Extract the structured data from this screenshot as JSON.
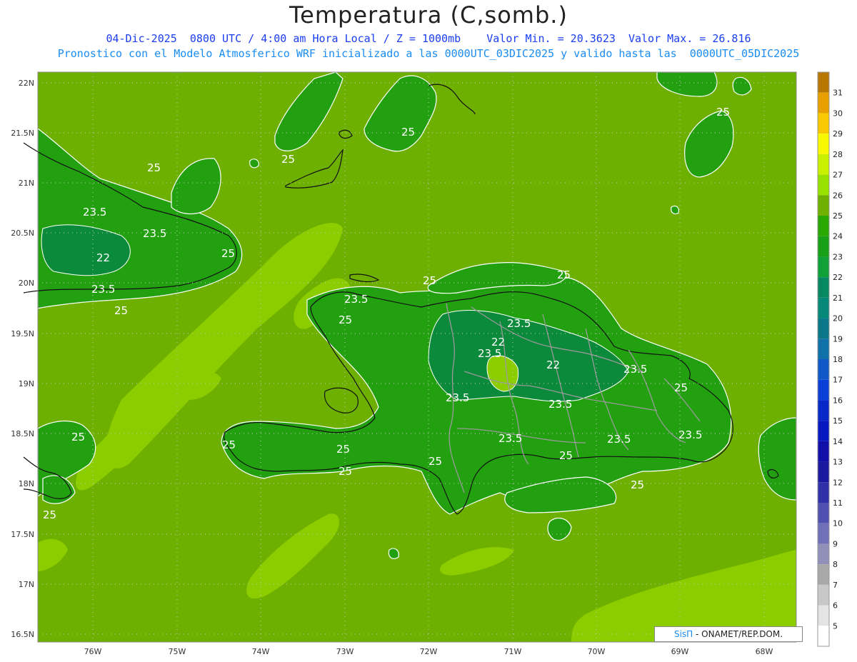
{
  "header": {
    "title": "Temperatura (C,somb.)",
    "line1": "04-Dic-2025  0800 UTC / 4:00 am Hora Local / Z = 1000mb    Valor Min. = 20.3623  Valor Max. = 26.816",
    "line2": "Pronostico con el Modelo Atmosferico WRF inicializado a las 0000UTC_03DIC2025 y valido hasta las  0000UTC_05DIC2025"
  },
  "map": {
    "lon_labels": [
      "76W",
      "75W",
      "74W",
      "73W",
      "72W",
      "71W",
      "70W",
      "69W",
      "68W"
    ],
    "lat_labels": [
      "22N",
      "21.5N",
      "21N",
      "20.5N",
      "20N",
      "19.5N",
      "19N",
      "18.5N",
      "18N",
      "17.5N",
      "17N",
      "16.5N"
    ],
    "contour_labels": [
      {
        "text": "25"
      },
      {
        "text": "25"
      },
      {
        "text": "25"
      },
      {
        "text": "25"
      },
      {
        "text": "25"
      },
      {
        "text": "23.5"
      },
      {
        "text": "23.5"
      },
      {
        "text": "22"
      },
      {
        "text": "23.5"
      },
      {
        "text": "25"
      },
      {
        "text": "25"
      },
      {
        "text": "25"
      },
      {
        "text": "23.5"
      },
      {
        "text": "25"
      },
      {
        "text": "23.5"
      },
      {
        "text": "22"
      },
      {
        "text": "23.5"
      },
      {
        "text": "22"
      },
      {
        "text": "23.5"
      },
      {
        "text": "25"
      },
      {
        "text": "23.5"
      },
      {
        "text": "23.5"
      },
      {
        "text": "23.5"
      },
      {
        "text": "23.5"
      },
      {
        "text": "25"
      },
      {
        "text": "25"
      },
      {
        "text": "25"
      },
      {
        "text": "25"
      },
      {
        "text": "25"
      },
      {
        "text": "25"
      },
      {
        "text": "25"
      },
      {
        "text": "25"
      },
      {
        "text": "23.5"
      }
    ]
  },
  "colorbar": {
    "labels": [
      "31",
      "30",
      "29",
      "28",
      "27",
      "26",
      "25",
      "24",
      "23",
      "22",
      "21",
      "20",
      "19",
      "18",
      "17",
      "16",
      "15",
      "14",
      "13",
      "12",
      "11",
      "10",
      "9",
      "8",
      "7",
      "6",
      "5"
    ],
    "colors": [
      "#b87800",
      "#e8a000",
      "#f8c800",
      "#f8f800",
      "#c8f000",
      "#98e000",
      "#70b000",
      "#28a800",
      "#18a018",
      "#10a038",
      "#088860",
      "#068878",
      "#0a7888",
      "#1070a8",
      "#1058c8",
      "#0a40d8",
      "#0828c8",
      "#0818c0",
      "#1010a8",
      "#1a1aa0",
      "#3030a8",
      "#5050b0",
      "#7070b8",
      "#9090b8",
      "#a8a8a8",
      "#c8c8c8",
      "#e4e4e4",
      "#ffffff"
    ]
  },
  "credit": {
    "sis": "SisΠ",
    "text": " - ONAMET/REP.DOM."
  }
}
